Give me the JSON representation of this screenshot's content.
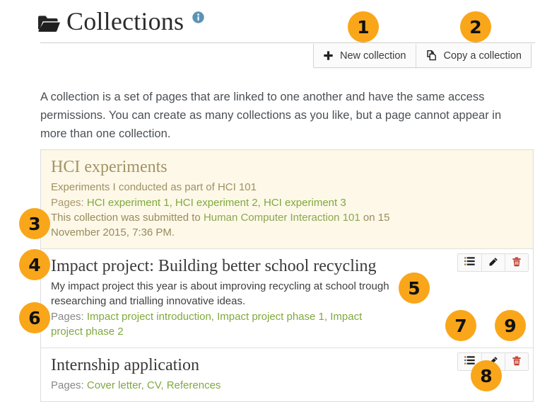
{
  "header": {
    "title": "Collections",
    "folder_icon": "folder-open-icon",
    "info_icon": "info-circle-icon",
    "info_color": "#5b93b5"
  },
  "toolbar": {
    "new_collection_label": "New collection",
    "new_collection_icon": "plus-icon",
    "copy_collection_label": "Copy a collection",
    "copy_collection_icon": "copy-pages-icon"
  },
  "intro": "A collection is a set of pages that are linked to one another and have the same access permissions. You can create as many collections as you like, but a page cannot appear in more than one collection.",
  "labels": {
    "pages_prefix": "Pages: ",
    "manage_pages_icon": "list-icon",
    "edit_icon": "pencil-icon",
    "delete_icon": "trash-icon"
  },
  "collections": [
    {
      "title": "HCI experiments",
      "description": "Experiments I conducted as part of HCI 101",
      "pages": "HCI experiment 1, HCI experiment 2, HCI experiment 3",
      "submitted_prefix": "This collection was submitted to ",
      "submitted_group": "Human Computer Interaction 101",
      "submitted_suffix": " on 15 November 2015, 7:36 PM.",
      "submitted": true,
      "has_actions": false
    },
    {
      "title": "Impact project: Building better school recycling",
      "description": "My impact project this year is about improving recycling at school trough researching and trialling innovative ideas.",
      "pages": "Impact project introduction, Impact project phase 1, Impact project phase 2",
      "submitted": false,
      "has_actions": true
    },
    {
      "title": "Internship application",
      "description": "",
      "pages": "Cover letter, CV, References",
      "submitted": false,
      "has_actions": true
    }
  ],
  "annotations": {
    "badge_color": "#f9a61a",
    "items": [
      {
        "number": "1",
        "refers_to": "new-collection-button"
      },
      {
        "number": "2",
        "refers_to": "copy-a-collection-button"
      },
      {
        "number": "3",
        "refers_to": "submitted-collection-row"
      },
      {
        "number": "4",
        "refers_to": "collection-title"
      },
      {
        "number": "5",
        "refers_to": "collection-description"
      },
      {
        "number": "6",
        "refers_to": "collection-pages-list"
      },
      {
        "number": "7",
        "refers_to": "manage-pages-button"
      },
      {
        "number": "8",
        "refers_to": "edit-collection-button"
      },
      {
        "number": "9",
        "refers_to": "delete-collection-button"
      }
    ]
  }
}
